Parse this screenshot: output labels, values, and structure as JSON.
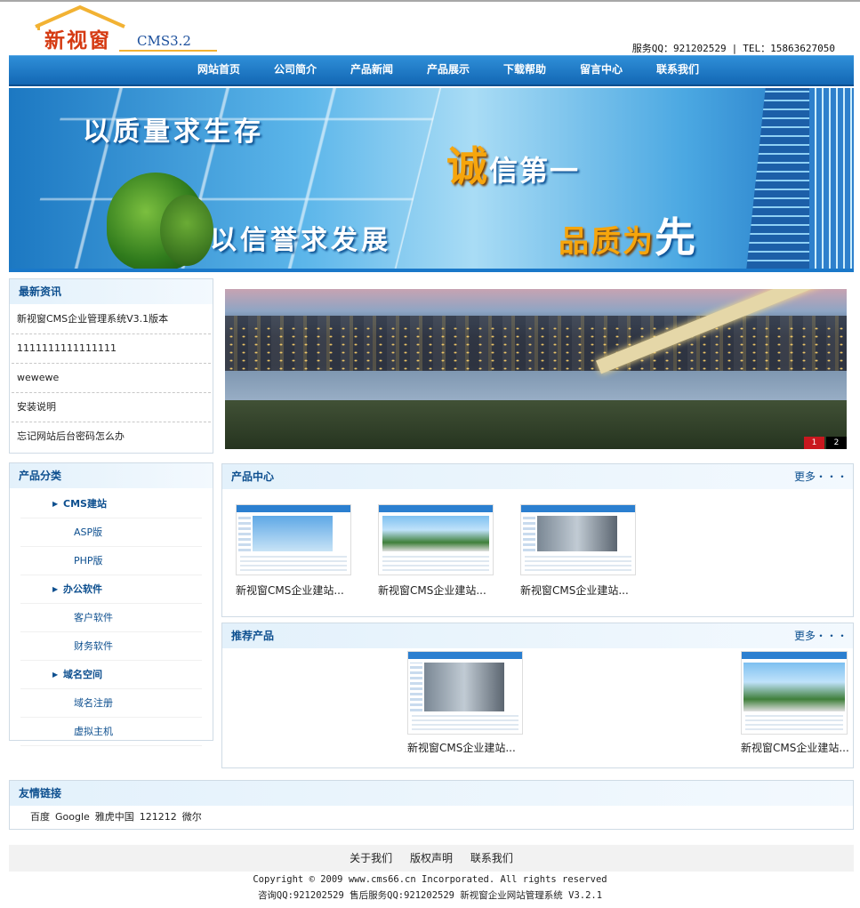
{
  "header": {
    "logo_text": "新视窗",
    "logo_sub": "CMS3.2",
    "service_qq": "服务QQ：921202529",
    "separator": "|",
    "tel": "TEL：15863627050"
  },
  "nav": {
    "items": [
      "网站首页",
      "公司简介",
      "产品新闻",
      "产品展示",
      "下载帮助",
      "留言中心",
      "联系我们"
    ]
  },
  "banner": {
    "slogan1": "以质量求生存",
    "slogan2": "以信誉求发展",
    "slogan3_big": "诚",
    "slogan3_rest": "信第一",
    "slogan4_rest": "品质为",
    "slogan4_big": "先"
  },
  "news": {
    "title": "最新资讯",
    "items": [
      "新视窗CMS企业管理系统V3.1版本",
      "1111111111111111",
      "wewewe",
      "安装说明",
      "忘记网站后台密码怎么办"
    ]
  },
  "slideshow": {
    "pages": [
      "1",
      "2"
    ],
    "active": "1"
  },
  "categories": {
    "title": "产品分类",
    "groups": [
      {
        "label": "CMS建站",
        "children": [
          "ASP版",
          "PHP版"
        ]
      },
      {
        "label": "办公软件",
        "children": [
          "客户软件",
          "财务软件"
        ]
      },
      {
        "label": "域名空间",
        "children": [
          "域名注册",
          "虚拟主机"
        ]
      }
    ]
  },
  "product_center": {
    "title": "产品中心",
    "more": "更多・・・",
    "items": [
      "新视窗CMS企业建站...",
      "新视窗CMS企业建站...",
      "新视窗CMS企业建站..."
    ]
  },
  "recommended": {
    "title": "推荐产品",
    "more": "更多・・・",
    "items": [
      "新视窗CMS企业建站...",
      "新视窗CMS企业建站..."
    ]
  },
  "friend_links": {
    "title": "友情链接",
    "items": [
      "百度",
      "Google",
      "雅虎中国",
      "121212",
      "微尔"
    ]
  },
  "footer": {
    "links": [
      "关于我们",
      "版权声明",
      "联系我们"
    ],
    "copyright": "Copyright © 2009 www.cms66.cn Incorporated. All rights reserved",
    "contact_line": "咨询QQ:921202529 售后服务QQ:921202529 新视窗企业网站管理系统 V3.2.1"
  },
  "colors": {
    "nav_blue": "#1367b4",
    "heading_blue": "#0d4f8f",
    "logo_red": "#d53a12",
    "accent_orange": "#f6a50c"
  }
}
